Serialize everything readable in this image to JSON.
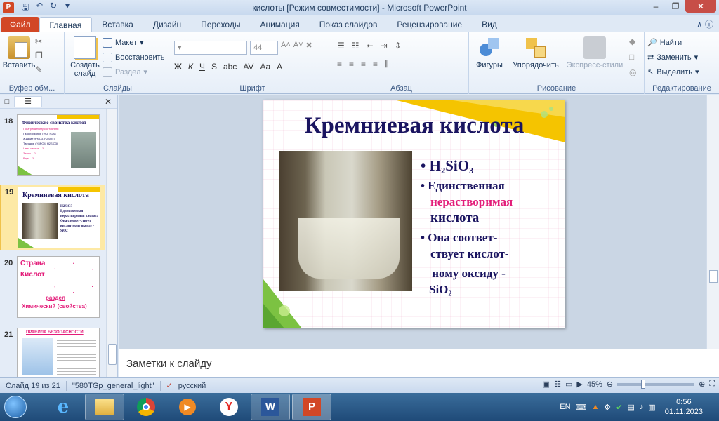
{
  "window": {
    "title": "кислоты [Режим совместимости]  -  Microsoft PowerPoint",
    "app_letter": "P"
  },
  "tabs": [
    "Файл",
    "Главная",
    "Вставка",
    "Дизайн",
    "Переходы",
    "Анимация",
    "Показ слайдов",
    "Рецензирование",
    "Вид"
  ],
  "ribbon": {
    "clipboard": {
      "paste": "Вставить",
      "label": "Буфер обм..."
    },
    "slides": {
      "new_slide_1": "Создать",
      "new_slide_2": "слайд",
      "layout": "Макет",
      "reset": "Восстановить",
      "section": "Раздел",
      "label": "Слайды"
    },
    "font": {
      "size": "44",
      "label": "Шрифт",
      "buttons": [
        "Ж",
        "К",
        "Ч",
        "S",
        "abc",
        "AV",
        "Aa",
        "A"
      ]
    },
    "paragraph": {
      "label": "Абзац"
    },
    "drawing": {
      "shapes": "Фигуры",
      "arrange": "Упорядочить",
      "styles": "Экспресс-стили",
      "label": "Рисование"
    },
    "editing": {
      "find": "Найти",
      "replace": "Заменить",
      "select": "Выделить",
      "label": "Редактирование"
    }
  },
  "thumbnails": [
    {
      "num": "18",
      "title": "Физические свойства кислот",
      "lines": [
        "По агрегатному состоянию:",
        "Газообразные (HCl, H2S)",
        "Жидкие (HNO3, H2SO4)",
        "Твердые (H3PO4, H2SiO3)",
        "Цвет кислот – ?",
        "Запах – ?",
        "Вкус – ?"
      ]
    },
    {
      "num": "19",
      "title": "Кремниевая кислота",
      "lines": [
        "H2SiO3",
        "Единственная нерастворимая кислота",
        "Она соответ-ствует кислот-ному оксиду - SiO2"
      ]
    },
    {
      "num": "20",
      "title": "Страна",
      "title2": "Кислот",
      "lines": [
        "раздел",
        "Химический (свойства)"
      ]
    },
    {
      "num": "21",
      "title": "ПРАВИЛА БЕЗОПАСНОСТИ",
      "lines": []
    }
  ],
  "slide": {
    "title": "Кремниевая  кислота",
    "b1": "H₂SiO₃",
    "b2_a": "Единственная",
    "b2_b": "нерастворимая",
    "b2_c": "кислота",
    "b3_a": "Она соответ-",
    "b3_b": "ствует кислот-",
    "b3_c": "ному оксиду -",
    "b3_d": "SiO₂"
  },
  "notes_placeholder": "Заметки к слайду",
  "status": {
    "slide_info": "Слайд 19 из 21",
    "theme": "\"580TGp_general_light\"",
    "language": "русский",
    "zoom": "45%"
  },
  "taskbar": {
    "lang": "EN",
    "time": "0:56",
    "date": "01.11.2023"
  },
  "colors": {
    "accent_file": "#d24726",
    "slide_title": "#1a1460",
    "pink": "#e31c79",
    "yellow": "#f5c400",
    "green": "#7cc242"
  }
}
